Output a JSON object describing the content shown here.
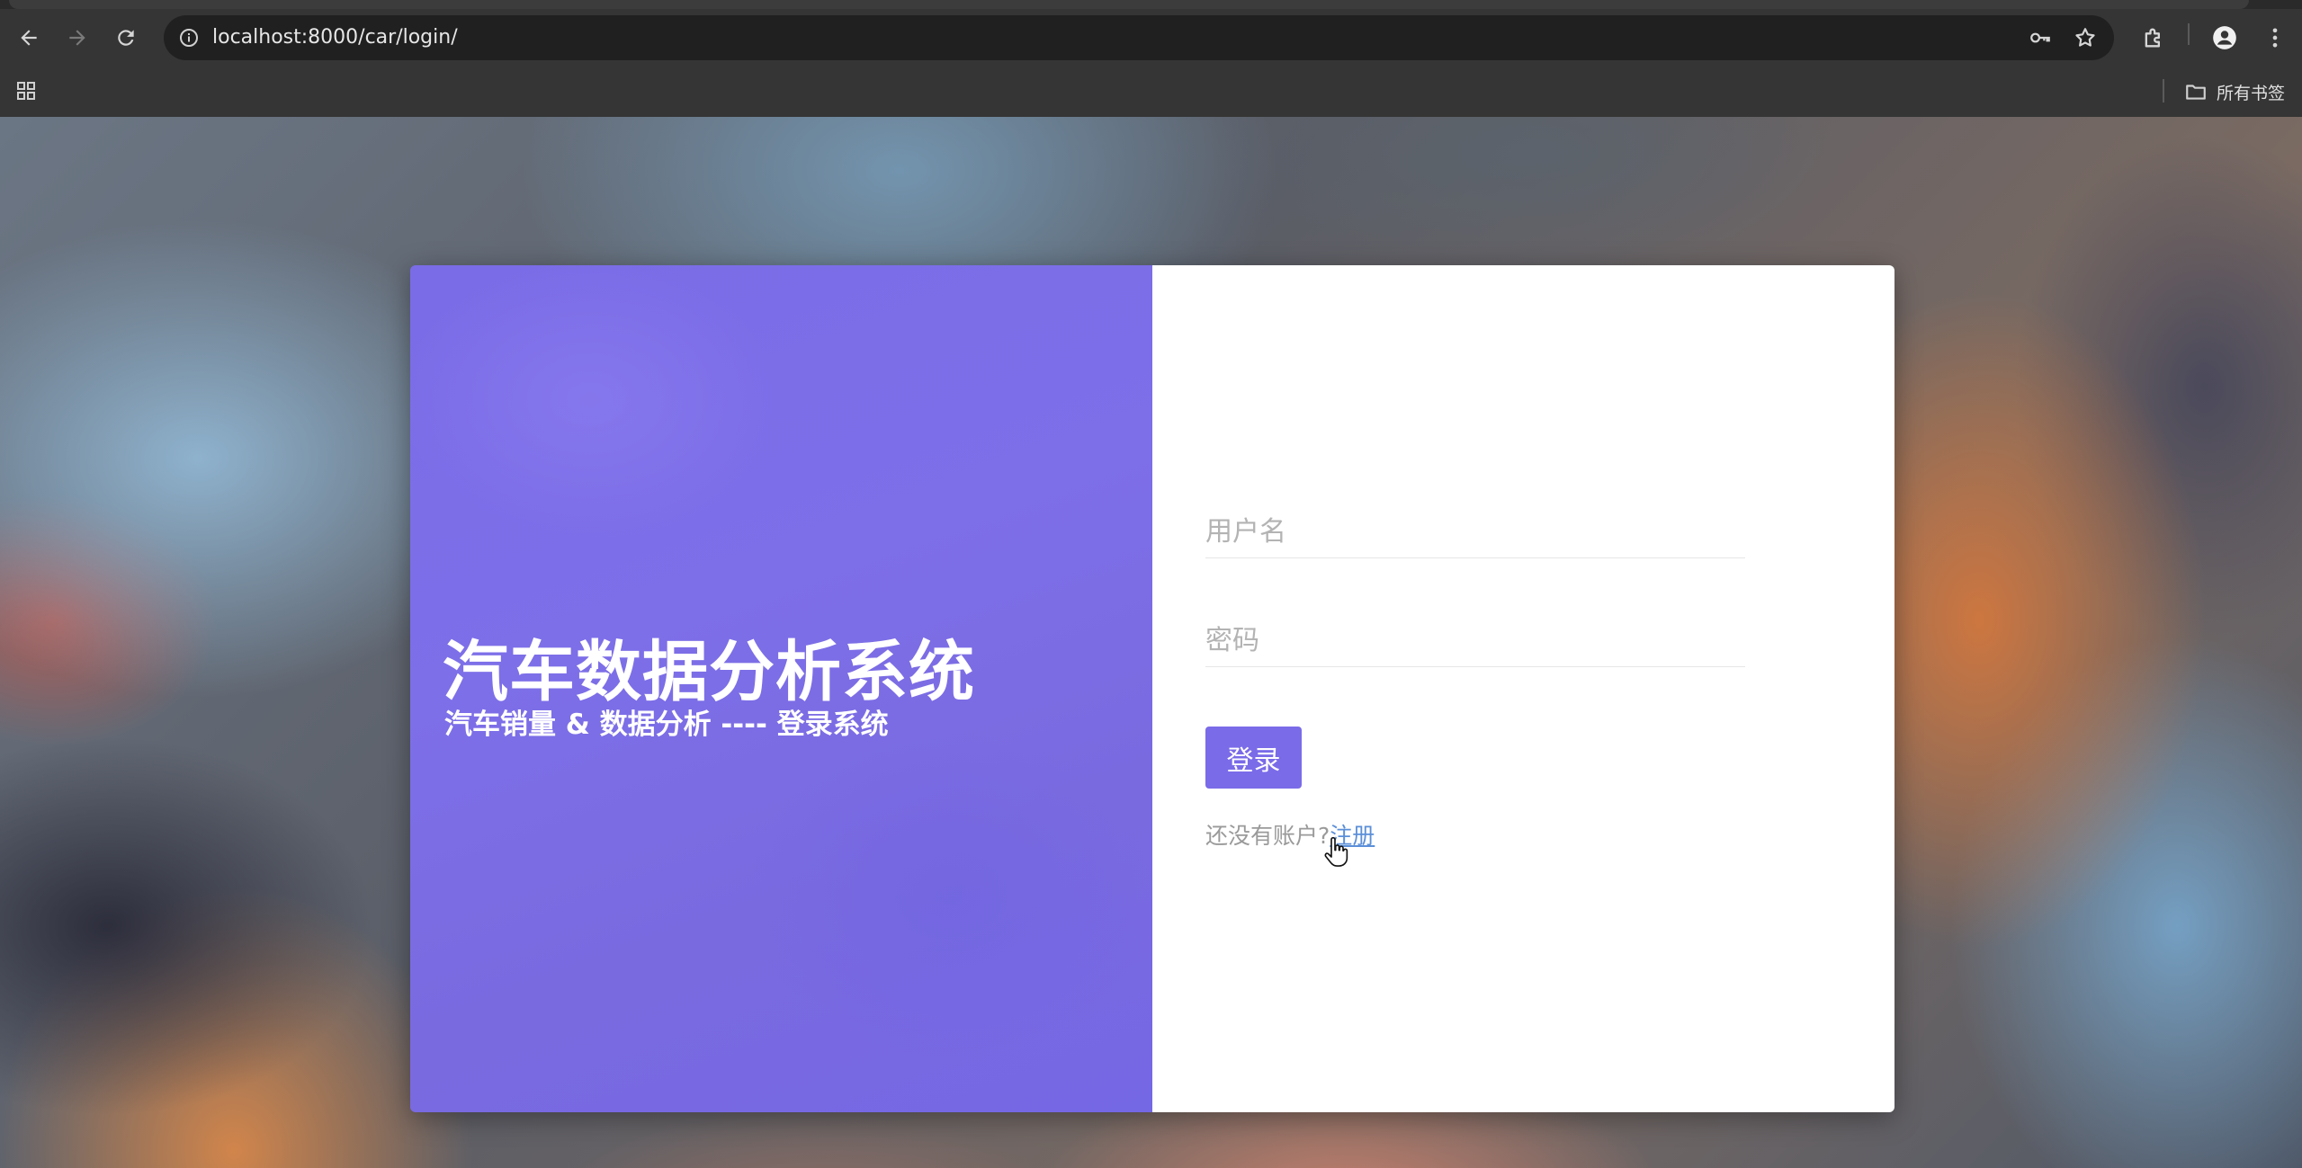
{
  "browser": {
    "url": "localhost:8000/car/login/",
    "bookmarks_label": "所有书签"
  },
  "login": {
    "title": "汽车数据分析系统",
    "subtitle": "汽车销量 & 数据分析 ---- 登录系统",
    "username_placeholder": "用户名",
    "password_placeholder": "密码",
    "submit_label": "登录",
    "register_prompt": "还没有账户?",
    "register_link": "注册"
  },
  "colors": {
    "accent": "#7a6be8",
    "link": "#5b8fd8"
  }
}
